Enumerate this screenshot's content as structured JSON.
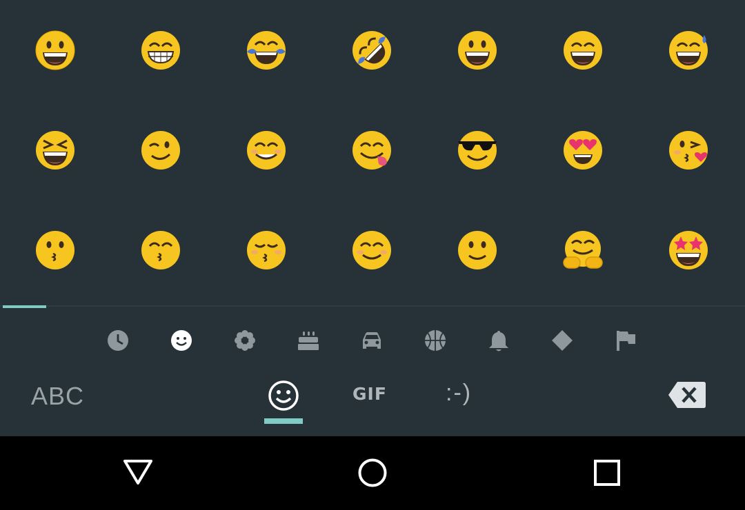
{
  "emoji_rows": [
    [
      "grinning-face-big-eyes",
      "grinning-face-smiling-eyes",
      "face-with-tears-of-joy",
      "rolling-on-floor-laughing",
      "grinning-face",
      "grinning-face-big-smile",
      "grinning-face-with-sweat"
    ],
    [
      "grinning-squinting-face",
      "winking-face",
      "smiling-face-smiling-eyes",
      "face-savoring-food",
      "smiling-face-with-sunglasses",
      "smiling-face-with-heart-eyes",
      "face-blowing-kiss"
    ],
    [
      "kissing-face",
      "kissing-face-smiling-eyes",
      "kissing-face-closed-eyes",
      "smiling-face-blush",
      "slightly-smiling-face",
      "hugging-face",
      "star-struck"
    ]
  ],
  "categories": [
    "recent-clock-icon",
    "smileys-icon",
    "nature-flower-icon",
    "food-cake-icon",
    "travel-car-icon",
    "activity-ball-icon",
    "objects-bell-icon",
    "symbols-diamond-icon",
    "flags-flag-icon"
  ],
  "bottom_bar": {
    "abc_label": "ABC",
    "gif_label": "GIF",
    "emoticon_label": ":-)",
    "active_mode": "emoji"
  },
  "nav": [
    "back-icon",
    "home-icon",
    "recents-icon"
  ],
  "colors": {
    "background": "#263238",
    "accent": "#80cbc4",
    "emoji_yellow": "#f7c520",
    "icon_gray": "#9aa3a8"
  }
}
